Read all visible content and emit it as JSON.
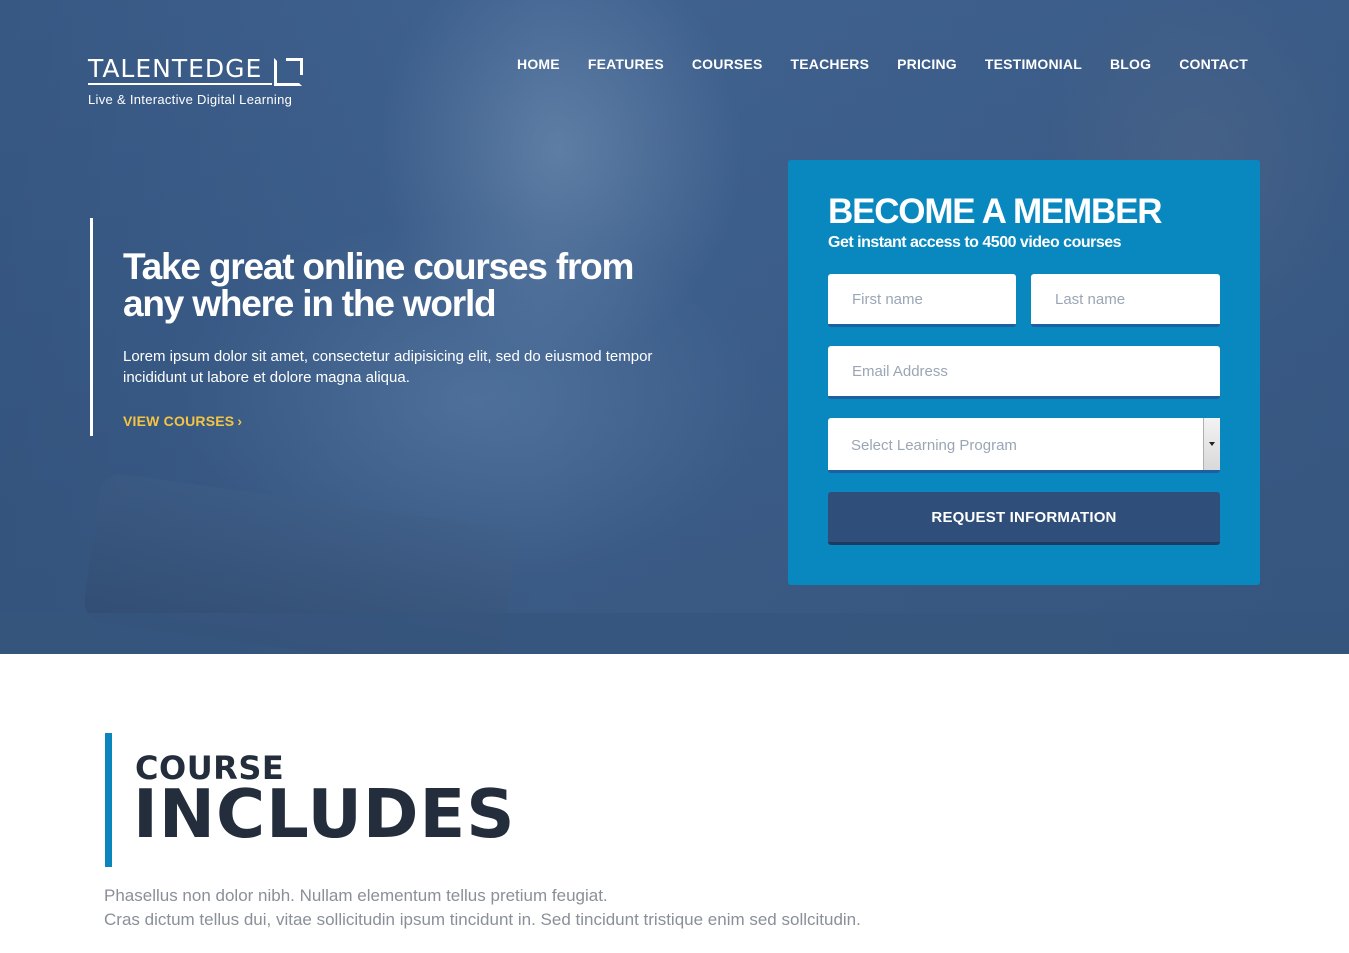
{
  "brand": {
    "name": "TALENTEDGE",
    "tagline": "Live & Interactive Digital Learning"
  },
  "nav": {
    "items": [
      "HOME",
      "FEATURES",
      "COURSES",
      "TEACHERS",
      "PRICING",
      "TESTIMONIAL",
      "BLOG",
      "CONTACT"
    ]
  },
  "hero": {
    "headline": "Take great online courses from any where in the world",
    "description": "Lorem ipsum dolor sit amet, consectetur adipisicing elit, sed do eiusmod tempor incididunt ut labore et dolore magna aliqua.",
    "cta_label": "VIEW COURSES",
    "cta_icon": "chevron-right-icon"
  },
  "member_form": {
    "title": "BECOME A MEMBER",
    "subtitle": "Get instant access to 4500 video courses",
    "first_name_placeholder": "First name",
    "last_name_placeholder": "Last name",
    "email_placeholder": "Email Address",
    "program_selected": "Select Learning Program",
    "submit_label": "REQUEST INFORMATION"
  },
  "course_includes": {
    "eyebrow": "COURSE",
    "title": "INCLUDES",
    "description_line1": "Phasellus non dolor nibh. Nullam elementum tellus pretium feugiat.",
    "description_line2": "Cras dictum tellus dui, vitae sollicitudin ipsum tincidunt in. Sed tincidunt tristique enim sed sollcitudin."
  },
  "colors": {
    "hero_overlay": "#3d5f8c",
    "form_background": "#0987bf",
    "button_background": "#2f4f7a",
    "cta_accent": "#f5c542",
    "section_bar": "#0a85bd",
    "heading_dark": "#232d3b"
  }
}
